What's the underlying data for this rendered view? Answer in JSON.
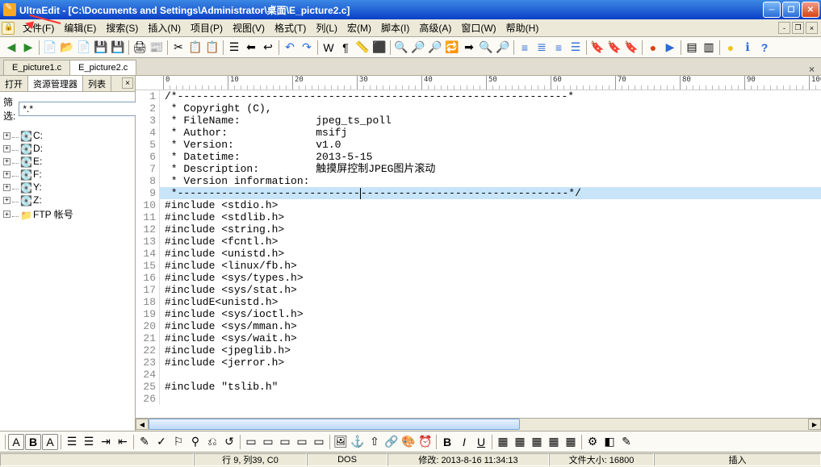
{
  "title": "UltraEdit - [C:\\Documents and Settings\\Administrator\\桌面\\E_picture2.c]",
  "menu": [
    "文件(F)",
    "编辑(E)",
    "搜索(S)",
    "插入(N)",
    "项目(P)",
    "视图(V)",
    "格式(T)",
    "列(L)",
    "宏(M)",
    "脚本(I)",
    "高级(A)",
    "窗口(W)",
    "帮助(H)"
  ],
  "tabs": [
    "E_picture1.c",
    "E_picture2.c"
  ],
  "active_tab": 1,
  "side": {
    "open_label": "打开",
    "tabs": [
      "资源管理器",
      "列表"
    ],
    "filter_label": "筛选:",
    "filter_value": "*.*",
    "items": [
      {
        "type": "drive",
        "label": "C:"
      },
      {
        "type": "drive",
        "label": "D:"
      },
      {
        "type": "drive",
        "label": "E:"
      },
      {
        "type": "drive",
        "label": "F:"
      },
      {
        "type": "drive",
        "label": "Y:"
      },
      {
        "type": "drive",
        "label": "Z:"
      },
      {
        "type": "ftp",
        "label": "FTP 帐号"
      }
    ]
  },
  "ruler": [
    "0",
    "10",
    "20",
    "30",
    "40",
    "50",
    "60",
    "70",
    "80",
    "90",
    "100"
  ],
  "code": [
    {
      "n": 1,
      "t": "/*--------------------------------------------------------------*"
    },
    {
      "n": 2,
      "t": " * Copyright (C),"
    },
    {
      "n": 3,
      "t": " * FileName:            jpeg_ts_poll"
    },
    {
      "n": 4,
      "t": " * Author:              msifj"
    },
    {
      "n": 5,
      "t": " * Version:             v1.0"
    },
    {
      "n": 6,
      "t": " * Datetime:            2013-5-15"
    },
    {
      "n": 7,
      "t": " * Description:         触摸屏控制JPEG图片滚动"
    },
    {
      "n": 8,
      "t": " * Version information:"
    },
    {
      "n": 9,
      "t": " *--------------------------------------------------------------*/",
      "hl": true,
      "caret": 31
    },
    {
      "n": 10,
      "t": "#include <stdio.h>"
    },
    {
      "n": 11,
      "t": "#include <stdlib.h>"
    },
    {
      "n": 12,
      "t": "#include <string.h>"
    },
    {
      "n": 13,
      "t": "#include <fcntl.h>"
    },
    {
      "n": 14,
      "t": "#include <unistd.h>"
    },
    {
      "n": 15,
      "t": "#include <linux/fb.h>"
    },
    {
      "n": 16,
      "t": "#include <sys/types.h>"
    },
    {
      "n": 17,
      "t": "#include <sys/stat.h>"
    },
    {
      "n": 18,
      "t": "#includE<unistd.h>"
    },
    {
      "n": 19,
      "t": "#include <sys/ioctl.h>"
    },
    {
      "n": 20,
      "t": "#include <sys/mman.h>"
    },
    {
      "n": 21,
      "t": "#include <sys/wait.h>"
    },
    {
      "n": 22,
      "t": "#include <jpeglib.h>"
    },
    {
      "n": 23,
      "t": "#include <jerror.h>"
    },
    {
      "n": 24,
      "t": ""
    },
    {
      "n": 25,
      "t": "#include \"tslib.h\""
    },
    {
      "n": 26,
      "t": ""
    }
  ],
  "status": {
    "pos": "行 9, 列39, C0",
    "enc": "DOS",
    "mod": "修改: 2013-8-16 11:34:13",
    "size": "文件大小: 16800",
    "ins": "插入"
  }
}
